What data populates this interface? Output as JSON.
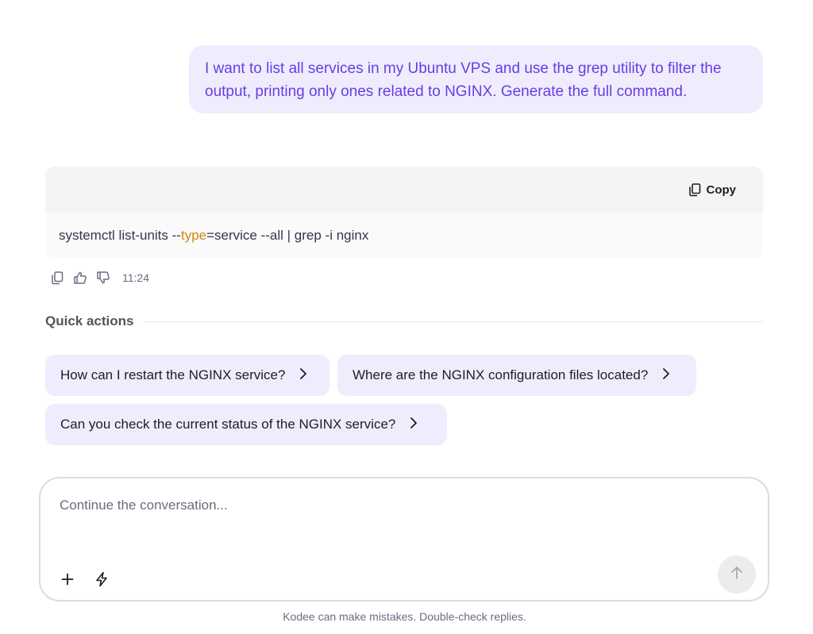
{
  "user_message": {
    "text": "I want to list all services in my Ubuntu VPS and use the grep utility to filter the output, printing only ones related to NGINX. Generate the full command."
  },
  "code_block": {
    "copy_label": "Copy",
    "copy_icon": "copy-icon",
    "code_parts": {
      "pre": "systemctl list-units --",
      "keyword": "type",
      "post": "=service --all | grep -i nginx"
    },
    "colors": {
      "keyword": "#d1870b"
    }
  },
  "message_actions": {
    "icons": [
      "copy-icon",
      "thumbs-up-icon",
      "thumbs-down-icon"
    ],
    "time": "11:24"
  },
  "quick_actions": {
    "title": "Quick actions",
    "items": [
      {
        "label": "How can I restart the NGINX service?"
      },
      {
        "label": "Where are the NGINX configuration files located?"
      },
      {
        "label": "Can you check the current status of the NGINX service?"
      }
    ]
  },
  "composer": {
    "placeholder": "Continue the conversation...",
    "value": "",
    "icons": [
      "plus-icon",
      "lightning-icon",
      "arrow-up-icon"
    ]
  },
  "footer": {
    "disclaimer": "Kodee can make mistakes. Double-check replies."
  },
  "colors": {
    "accent": "#673de6",
    "bubble_bg": "#efedfd"
  }
}
